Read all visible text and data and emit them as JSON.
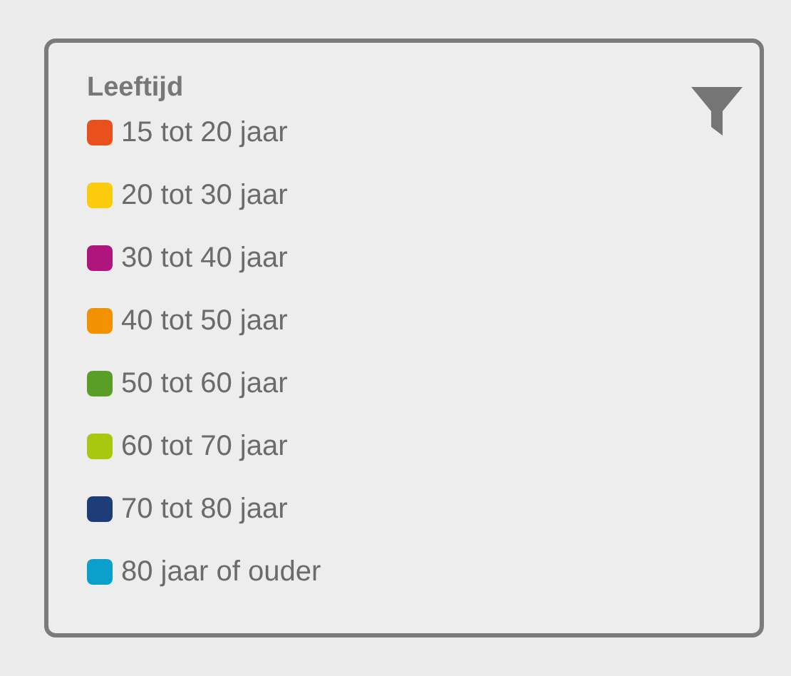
{
  "legend": {
    "title": "Leeftijd",
    "items": [
      {
        "label": "15 tot 20 jaar",
        "color": "#e8501c"
      },
      {
        "label": "20 tot 30 jaar",
        "color": "#fccc0c"
      },
      {
        "label": "30 tot 40 jaar",
        "color": "#b0157e"
      },
      {
        "label": "40 tot 50 jaar",
        "color": "#f39200"
      },
      {
        "label": "50 tot 60 jaar",
        "color": "#5a9e28"
      },
      {
        "label": "60 tot 70 jaar",
        "color": "#a8c80f"
      },
      {
        "label": "70 tot 80 jaar",
        "color": "#1e3c78"
      },
      {
        "label": "80 jaar of ouder",
        "color": "#0aa0cb"
      }
    ]
  }
}
